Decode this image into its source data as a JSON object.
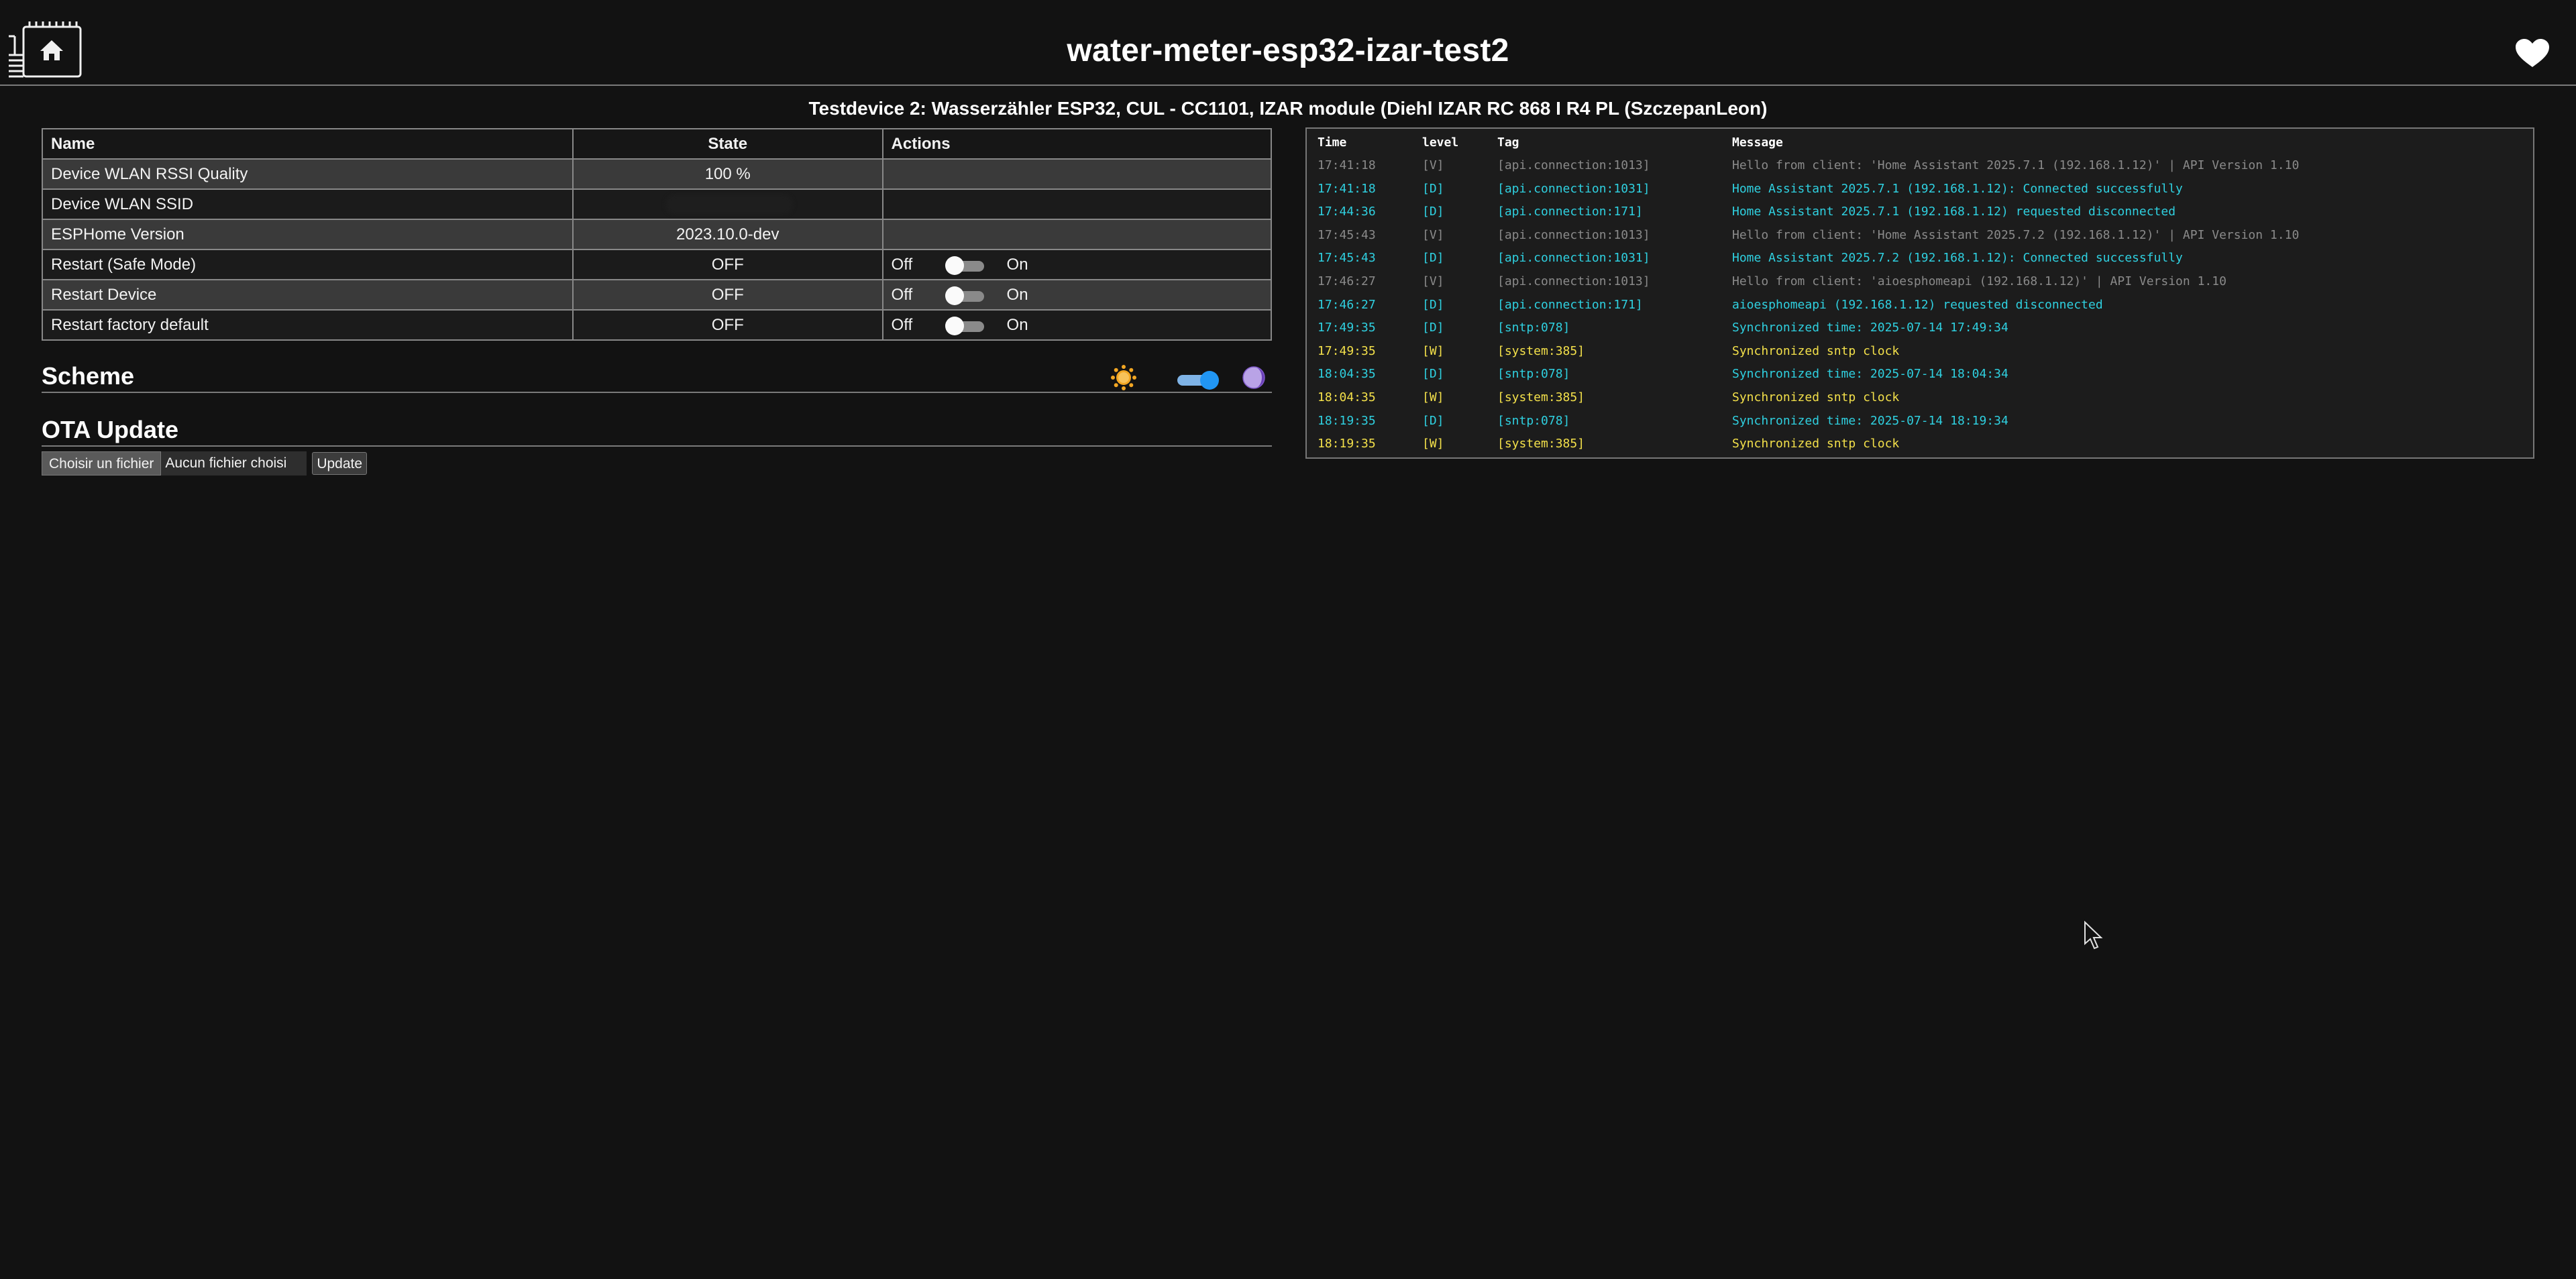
{
  "header": {
    "title": "water-meter-esp32-izar-test2",
    "logo_icon": "esphome-chip-home-icon",
    "heart_icon": "heart-icon"
  },
  "subtitle": "Testdevice 2: Wasserzähler ESP32, CUL - CC1101, IZAR module (Diehl IZAR RC 868 I R4 PL (SzczepanLeon)",
  "entities": {
    "headers": {
      "name": "Name",
      "state": "State",
      "actions": "Actions"
    },
    "rows": [
      {
        "name": "Device WLAN RSSI Quality",
        "state": "100 %",
        "action": ""
      },
      {
        "name": "Device WLAN SSID",
        "state": "",
        "action": ""
      },
      {
        "name": "ESPHome Version",
        "state": "2023.10.0-dev",
        "action": ""
      },
      {
        "name": "Restart (Safe Mode)",
        "state": "OFF",
        "action": "switch",
        "off_label": "Off",
        "on_label": "On"
      },
      {
        "name": "Restart Device",
        "state": "OFF",
        "action": "switch",
        "off_label": "Off",
        "on_label": "On"
      },
      {
        "name": "Restart factory default",
        "state": "OFF",
        "action": "switch",
        "off_label": "Off",
        "on_label": "On"
      }
    ]
  },
  "scheme": {
    "title": "Scheme",
    "mode": "dark"
  },
  "ota": {
    "title": "OTA Update",
    "choose_label": "Choisir un fichier",
    "file_label": "Aucun fichier choisi",
    "update_label": "Update"
  },
  "log": {
    "headers": {
      "time": "Time",
      "level": "level",
      "tag": "Tag",
      "message": "Message"
    },
    "entries": [
      {
        "time": "17:41:18",
        "level": "[V]",
        "tag": "[api.connection:1013]",
        "message": "Hello from client: 'Home Assistant 2025.7.1 (192.168.1.12)' | API Version 1.10"
      },
      {
        "time": "17:41:18",
        "level": "[D]",
        "tag": "[api.connection:1031]",
        "message": "Home Assistant 2025.7.1 (192.168.1.12): Connected successfully"
      },
      {
        "time": "17:44:36",
        "level": "[D]",
        "tag": "[api.connection:171]",
        "message": "Home Assistant 2025.7.1 (192.168.1.12) requested disconnected"
      },
      {
        "time": "17:45:43",
        "level": "[V]",
        "tag": "[api.connection:1013]",
        "message": "Hello from client: 'Home Assistant 2025.7.2 (192.168.1.12)' | API Version 1.10"
      },
      {
        "time": "17:45:43",
        "level": "[D]",
        "tag": "[api.connection:1031]",
        "message": "Home Assistant 2025.7.2 (192.168.1.12): Connected successfully"
      },
      {
        "time": "17:46:27",
        "level": "[V]",
        "tag": "[api.connection:1013]",
        "message": "Hello from client: 'aioesphomeapi (192.168.1.12)' | API Version 1.10"
      },
      {
        "time": "17:46:27",
        "level": "[D]",
        "tag": "[api.connection:171]",
        "message": "aioesphomeapi (192.168.1.12) requested disconnected"
      },
      {
        "time": "17:49:35",
        "level": "[D]",
        "tag": "[sntp:078]",
        "message": "Synchronized time: 2025-07-14 17:49:34"
      },
      {
        "time": "17:49:35",
        "level": "[W]",
        "tag": "[system:385]",
        "message": "Synchronized sntp clock"
      },
      {
        "time": "18:04:35",
        "level": "[D]",
        "tag": "[sntp:078]",
        "message": "Synchronized time: 2025-07-14 18:04:34"
      },
      {
        "time": "18:04:35",
        "level": "[W]",
        "tag": "[system:385]",
        "message": "Synchronized sntp clock"
      },
      {
        "time": "18:19:35",
        "level": "[D]",
        "tag": "[sntp:078]",
        "message": "Synchronized time: 2025-07-14 18:19:34"
      },
      {
        "time": "18:19:35",
        "level": "[W]",
        "tag": "[system:385]",
        "message": "Synchronized sntp clock"
      }
    ]
  },
  "colors": {
    "background": "#121212",
    "log_verbose": "#8a8a8a",
    "log_debug": "#2fd0e0",
    "log_warning": "#f3e04a",
    "switch_on": "#2196f3"
  }
}
